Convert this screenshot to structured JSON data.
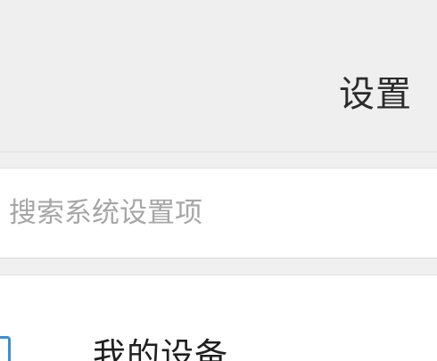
{
  "header": {
    "title": "设置"
  },
  "search": {
    "placeholder": "搜索系统设置项",
    "value": ""
  },
  "list": {
    "items": [
      {
        "label": "我的设备",
        "icon": "device-icon"
      }
    ]
  },
  "colors": {
    "background": "#efefef",
    "card": "#ffffff",
    "accent": "#3b8fd6",
    "placeholder": "#a6a6a6",
    "title": "#2b2b2b"
  }
}
